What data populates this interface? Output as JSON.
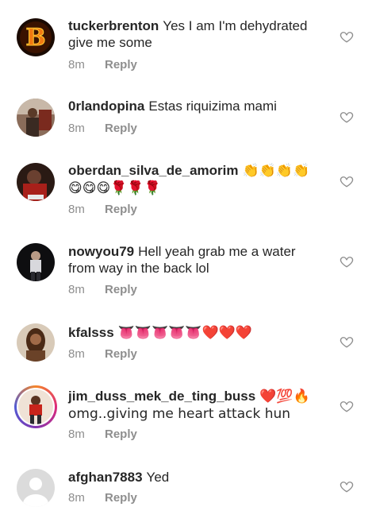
{
  "comments": [
    {
      "username": "tuckerbrenton",
      "text": "Yes I am I'm dehydrated give me some",
      "time": "8m",
      "reply": "Reply",
      "avatar_icon": "flaming-b-avatar"
    },
    {
      "username": "0rlandopina",
      "text": "Estas riquizima  mami",
      "time": "8m",
      "reply": "Reply",
      "avatar_icon": "photo-avatar"
    },
    {
      "username": "oberdan_silva_de_amorim",
      "text": "👏👏👏👏 😋😋😋🌹🌹🌹",
      "time": "8m",
      "reply": "Reply",
      "avatar_icon": "photo-avatar"
    },
    {
      "username": "nowyou79",
      "text": "Hell yeah grab me a water from way in the back lol",
      "time": "8m",
      "reply": "Reply",
      "avatar_icon": "photo-avatar"
    },
    {
      "username": "kfalsss",
      "text": "👅👅👅👅👅❤️❤️❤️",
      "time": "8m",
      "reply": "Reply",
      "avatar_icon": "photo-avatar"
    },
    {
      "username": "jim_duss_mek_de_ting_buss",
      "text": "❤️💯🔥 omg..giving me heart attack hun",
      "time": "8m",
      "reply": "Reply",
      "avatar_icon": "story-ring-avatar"
    },
    {
      "username": "afghan7883",
      "text": "Yed",
      "time": "8m",
      "reply": "Reply",
      "avatar_icon": "default-avatar"
    }
  ],
  "colors": {
    "username": "#262626",
    "meta": "#8e8e8e",
    "heart_outline": "#8e8e8e"
  }
}
